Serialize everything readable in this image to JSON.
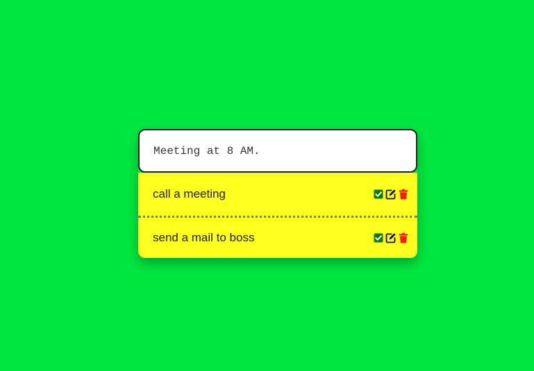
{
  "todo_input": {
    "value": "Meeting at 8 AM."
  },
  "todos": [
    {
      "text": "call a meeting"
    },
    {
      "text": "send a mail to boss"
    }
  ],
  "icons": {
    "complete": "check-square-icon",
    "edit": "edit-icon",
    "delete": "trash-icon"
  },
  "colors": {
    "background": "#00e640",
    "list_background": "#ffff20",
    "complete_icon": "#0a7a0a",
    "edit_icon": "#111111",
    "delete_icon": "#ff1a1a"
  }
}
